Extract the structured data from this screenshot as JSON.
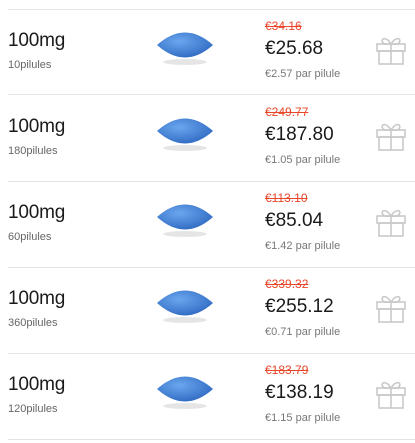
{
  "rows": [
    {
      "dose": "100mg",
      "qty": "10pilules",
      "old_price": "€34.16",
      "new_price": "€25.68",
      "per_pill": "€2.57 par pilule"
    },
    {
      "dose": "100mg",
      "qty": "180pilules",
      "old_price": "€249.77",
      "new_price": "€187.80",
      "per_pill": "€1.05 par pilule"
    },
    {
      "dose": "100mg",
      "qty": "60pilules",
      "old_price": "€113.10",
      "new_price": "€85.04",
      "per_pill": "€1.42 par pilule"
    },
    {
      "dose": "100mg",
      "qty": "360pilules",
      "old_price": "€339.32",
      "new_price": "€255.12",
      "per_pill": "€0.71 par pilule"
    },
    {
      "dose": "100mg",
      "qty": "120pilules",
      "old_price": "€183.79",
      "new_price": "€138.19",
      "per_pill": "€1.15 par pilule"
    }
  ],
  "icons": {
    "pill": "blue-pill-icon",
    "gift": "gift-icon"
  },
  "colors": {
    "old_price": "#e8472a",
    "pill": "#3f7fd4"
  }
}
